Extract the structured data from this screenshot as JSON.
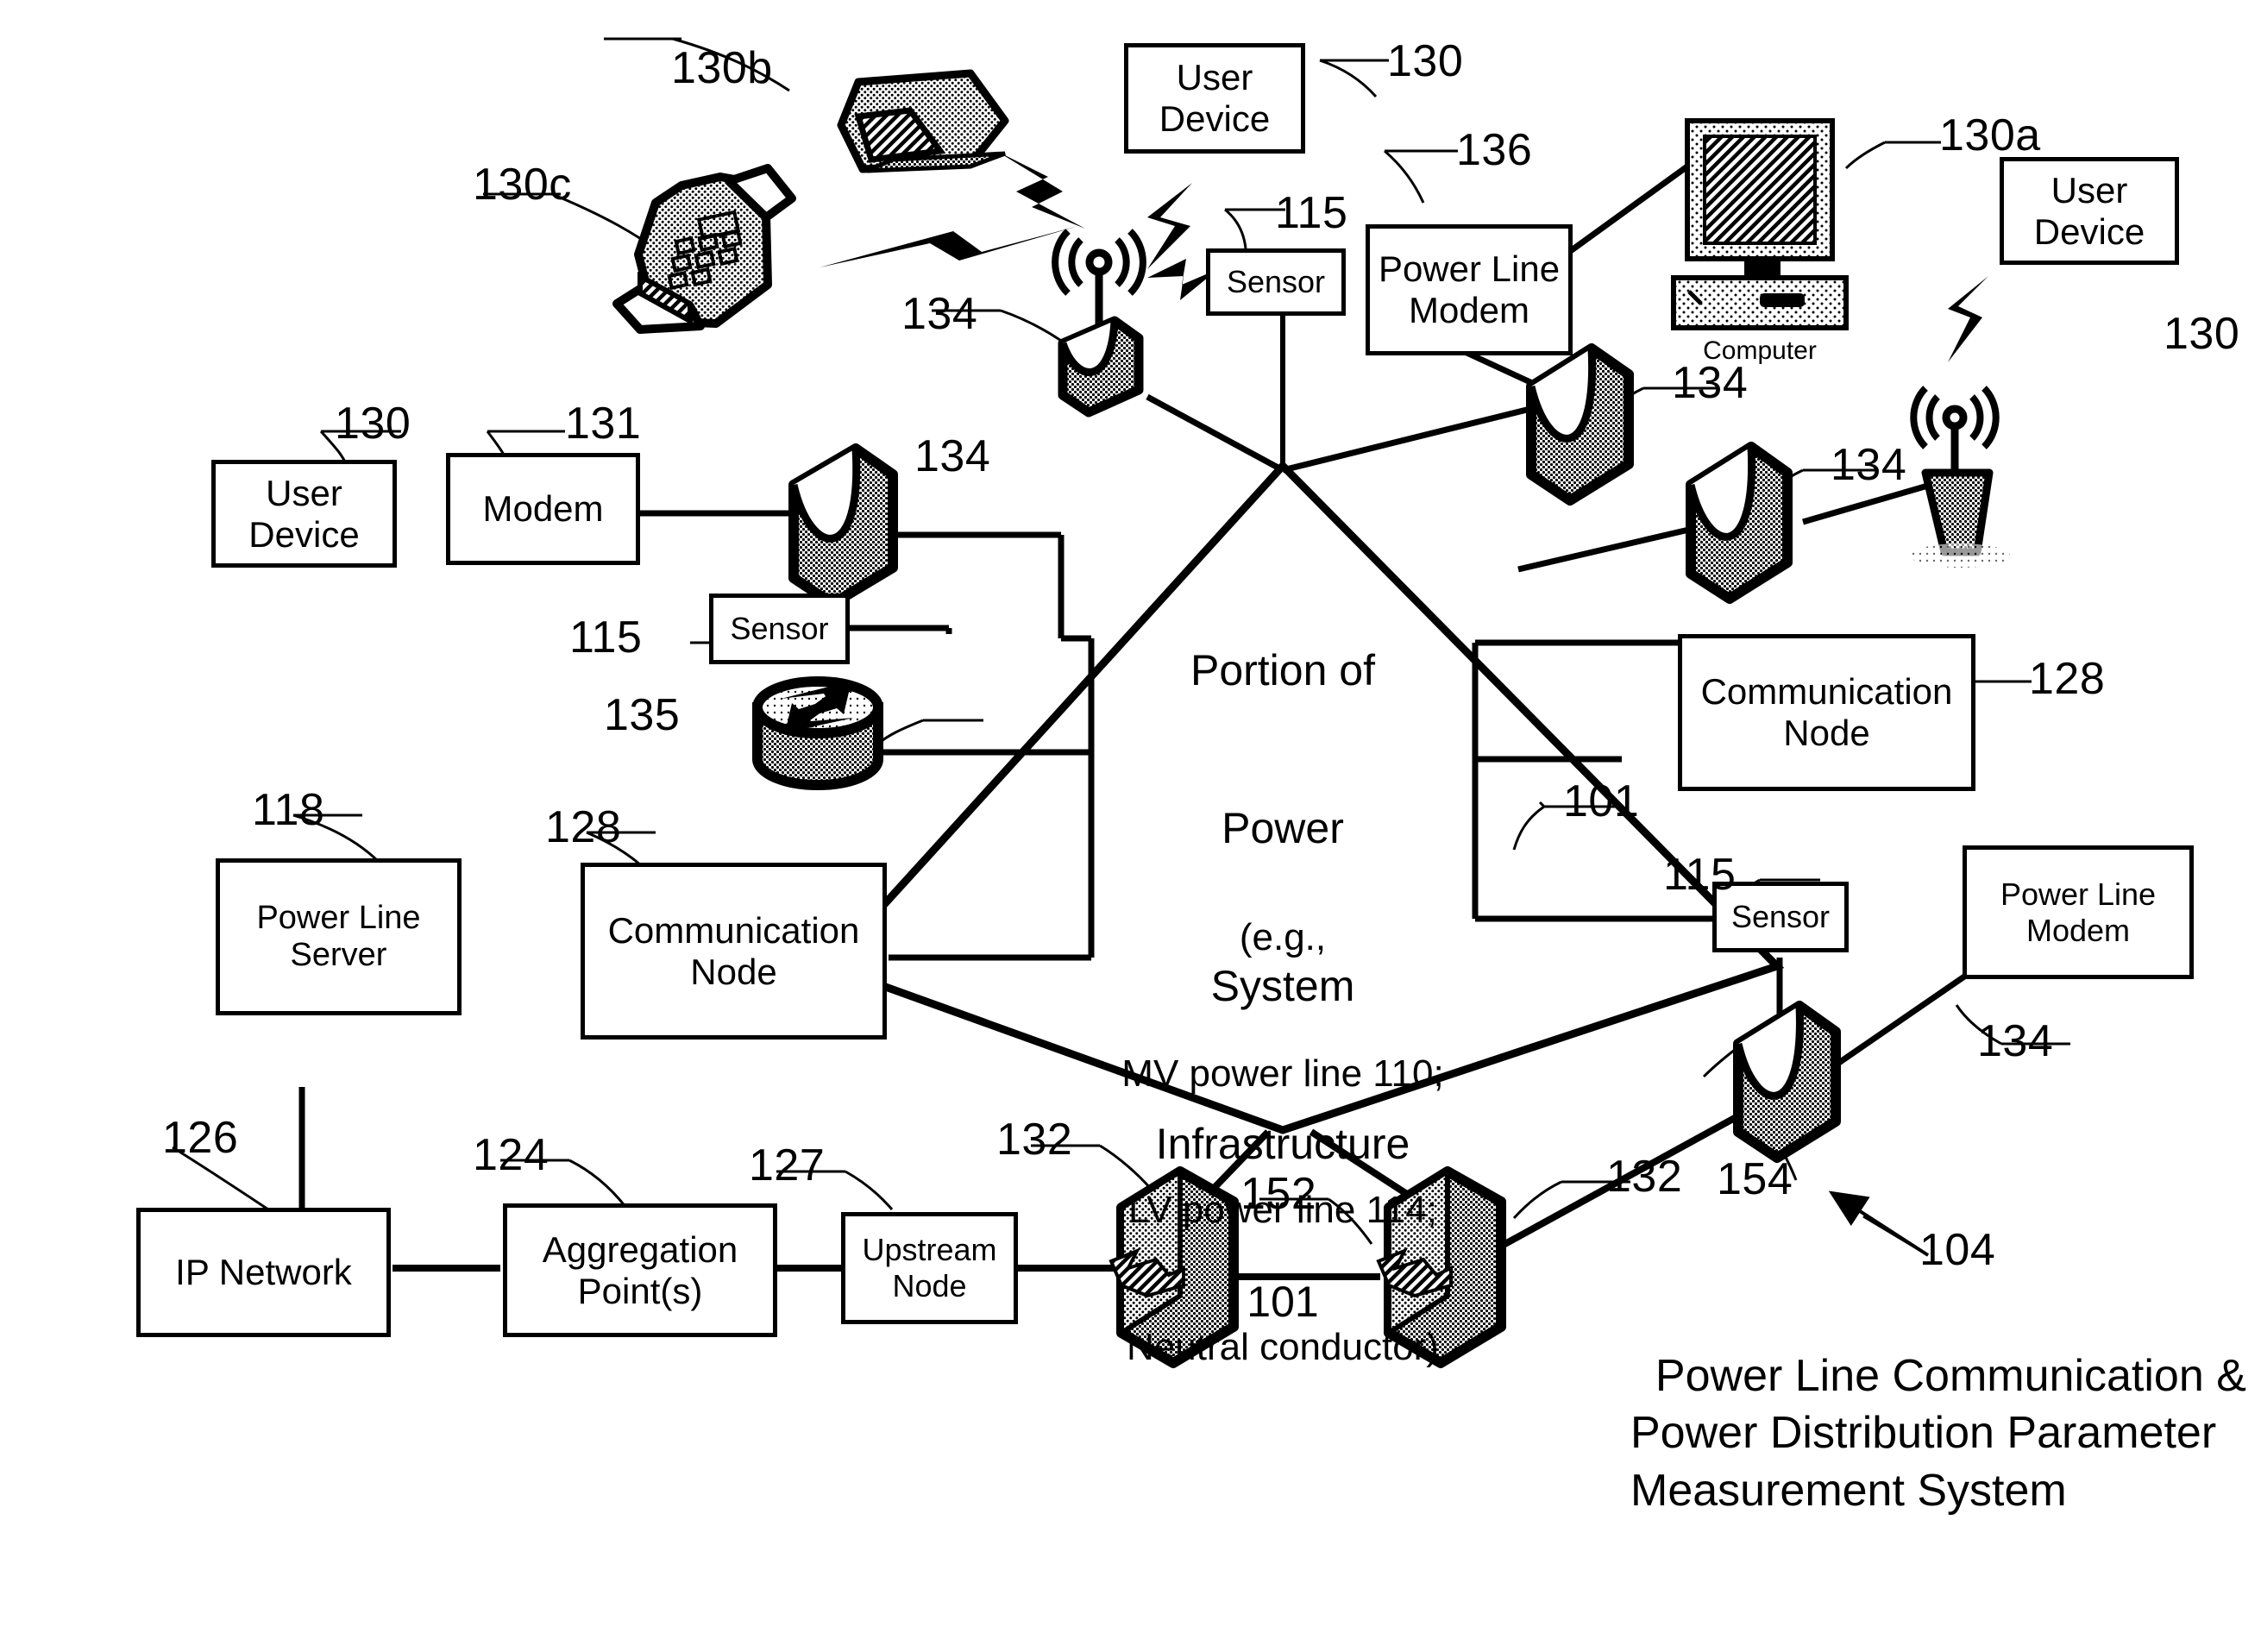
{
  "figure": {
    "system_name": "Power Line Communication &\nPower Distribution Parameter\nMeasurement System",
    "system_ref": "104",
    "center": {
      "title_line1": "Portion of",
      "title_line2": "Power",
      "title_line3": "System",
      "title_line4": "Infrastructure",
      "ref": "101",
      "note_line1": "(e.g.,",
      "note_line2": "MV power line 110;",
      "note_line3": "LV power line 114;",
      "note_line4": "Neutral conductor)"
    },
    "boxes": [
      {
        "id": "user-device-left",
        "label": "User\nDevice",
        "ref": "130"
      },
      {
        "id": "modem-left",
        "label": "Modem",
        "ref": "131"
      },
      {
        "id": "sensor-left",
        "label": "Sensor",
        "ref": "115"
      },
      {
        "id": "user-device-top",
        "label": "User\nDevice",
        "ref": "130"
      },
      {
        "id": "sensor-top",
        "label": "Sensor",
        "ref": "115"
      },
      {
        "id": "power-line-modem-top",
        "label": "Power Line\nModem",
        "ref": "136"
      },
      {
        "id": "user-device-right",
        "label": "User\nDevice",
        "ref": "130a"
      },
      {
        "id": "communication-node-right",
        "label": "Communication\nNode",
        "ref": "128"
      },
      {
        "id": "sensor-right",
        "label": "Sensor",
        "ref": "115"
      },
      {
        "id": "power-line-modem-right",
        "label": "Power Line\nModem",
        "ref": ""
      },
      {
        "id": "power-line-server",
        "label": "Power Line\nServer",
        "ref": "118"
      },
      {
        "id": "communication-node-left",
        "label": "Communication\nNode",
        "ref": "128"
      },
      {
        "id": "ip-network",
        "label": "IP Network",
        "ref": "126"
      },
      {
        "id": "aggregation-points",
        "label": "Aggregation\nPoint(s)",
        "ref": "124"
      },
      {
        "id": "upstream-node",
        "label": "Upstream\nNode",
        "ref": "127"
      }
    ],
    "icons": [
      {
        "id": "laptop-icon",
        "name": "laptop",
        "ref": "130b"
      },
      {
        "id": "fax-icon",
        "name": "fax-printer",
        "ref": "130c"
      },
      {
        "id": "antenna-icon-1",
        "name": "wireless-antenna",
        "ref": "134"
      },
      {
        "id": "antenna-icon-2",
        "name": "wireless-antenna",
        "ref": "134"
      },
      {
        "id": "router-icon",
        "name": "router",
        "ref": "135"
      },
      {
        "id": "computer-icon",
        "name": "desktop-computer",
        "ref": "130a",
        "caption": "Computer"
      },
      {
        "id": "coupler-1",
        "name": "power-line-coupler",
        "ref": "134"
      },
      {
        "id": "coupler-2",
        "name": "power-line-coupler",
        "ref": "134"
      },
      {
        "id": "coupler-3",
        "name": "power-line-coupler",
        "ref": "134"
      },
      {
        "id": "coupler-4",
        "name": "power-line-coupler",
        "ref": "134"
      },
      {
        "id": "coupler-5",
        "name": "power-line-coupler",
        "ref": "134"
      },
      {
        "id": "transformer-1",
        "name": "distribution-transformer",
        "ref": "132"
      },
      {
        "id": "transformer-2",
        "name": "distribution-transformer",
        "ref": "132"
      }
    ],
    "refs": {
      "r101_right": "101",
      "r104": "104",
      "r115_left": "115",
      "r115_top": "115",
      "r115_right": "115",
      "r118": "118",
      "r124": "124",
      "r126": "126",
      "r127": "127",
      "r128_left": "128",
      "r128_right": "128",
      "r130_left": "130",
      "r130_top": "130",
      "r130_right": "130",
      "r130a": "130a",
      "r130b": "130b",
      "r130c": "130c",
      "r131": "131",
      "r132_left": "132",
      "r132_right": "132",
      "r134_a": "134",
      "r134_b": "134",
      "r134_c": "134",
      "r134_d": "134",
      "r134_e": "134",
      "r135": "135",
      "r136": "136",
      "r152": "152",
      "r154": "154"
    },
    "labels": {
      "computer_caption": "Computer"
    },
    "colors": {
      "line": "#000000",
      "background": "#ffffff",
      "fill_light": "#f2f2f2",
      "fill_mid": "#d9d9d9"
    }
  }
}
